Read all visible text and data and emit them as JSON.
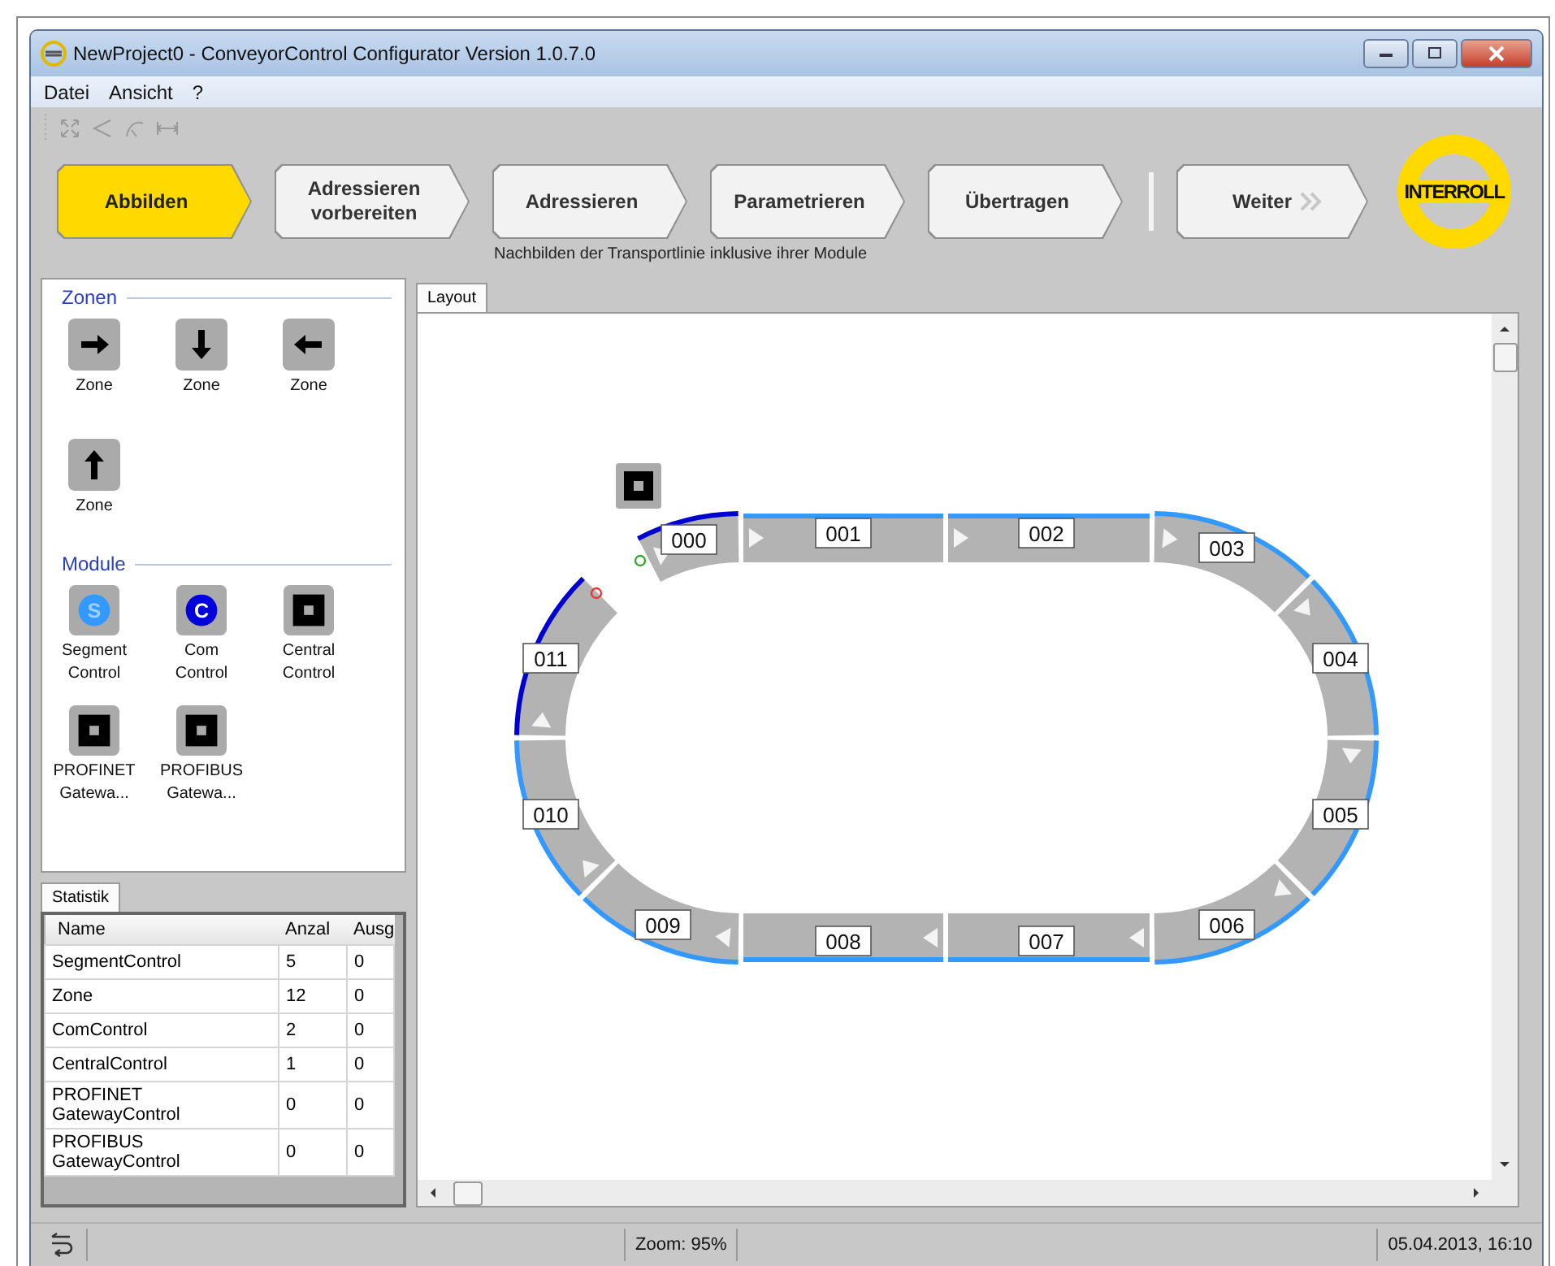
{
  "window": {
    "title": "NewProject0 - ConveyorControl Configurator Version 1.0.7.0"
  },
  "menu": [
    "Datei",
    "Ansicht",
    "?"
  ],
  "wizard": {
    "steps": [
      {
        "label": "Abbilden",
        "selected": true
      },
      {
        "label": "Adressieren vorbereiten",
        "selected": false
      },
      {
        "label": "Adressieren",
        "selected": false
      },
      {
        "label": "Parametrieren",
        "selected": false
      },
      {
        "label": "Übertragen",
        "selected": false
      }
    ],
    "next": "Weiter",
    "hint": "Nachbilden der Transportlinie inklusive ihrer Module"
  },
  "logo": "INTERROLL",
  "palette": [
    {
      "title": "Zonen",
      "items": [
        {
          "kind": "arrow_right",
          "label": "Zone"
        },
        {
          "kind": "arrow_down",
          "label": "Zone"
        },
        {
          "kind": "arrow_left",
          "label": "Zone"
        },
        {
          "kind": "arrow_up",
          "label": "Zone"
        }
      ]
    },
    {
      "title": "Module",
      "items": [
        {
          "kind": "segment",
          "glyph": "S",
          "label": "Segment Control"
        },
        {
          "kind": "com",
          "glyph": "C",
          "label": "Com Control"
        },
        {
          "kind": "module",
          "label": "Central Control"
        },
        {
          "kind": "module",
          "label": "PROFINET Gatewa..."
        },
        {
          "kind": "module",
          "label": "PROFIBUS Gatewa..."
        }
      ]
    }
  ],
  "statistics": {
    "tab": "Statistik",
    "columns": [
      "Name",
      "Anzal",
      "Ausg"
    ],
    "rows": [
      [
        "SegmentControl",
        "5",
        "0"
      ],
      [
        "Zone",
        "12",
        "0"
      ],
      [
        "ComControl",
        "2",
        "0"
      ],
      [
        "CentralControl",
        "1",
        "0"
      ],
      [
        "PROFINET GatewayControl",
        "0",
        "0"
      ],
      [
        "PROFIBUS GatewayControl",
        "0",
        "0"
      ]
    ]
  },
  "layout": {
    "tab": "Layout",
    "zones": [
      {
        "label": "000",
        "color": "#0000cc"
      },
      {
        "label": "001",
        "color": "#3399ff"
      },
      {
        "label": "002",
        "color": "#3399ff"
      },
      {
        "label": "003",
        "color": "#3399ff"
      },
      {
        "label": "004",
        "color": "#3399ff"
      },
      {
        "label": "005",
        "color": "#3399ff"
      },
      {
        "label": "006",
        "color": "#3399ff"
      },
      {
        "label": "007",
        "color": "#3399ff"
      },
      {
        "label": "008",
        "color": "#3399ff"
      },
      {
        "label": "009",
        "color": "#3399ff"
      },
      {
        "label": "010",
        "color": "#3399ff"
      },
      {
        "label": "011",
        "color": "#0000cc"
      }
    ]
  },
  "status_bar": {
    "zoom": "Zoom: 95%",
    "datetime": "05.04.2013, 16:10"
  }
}
